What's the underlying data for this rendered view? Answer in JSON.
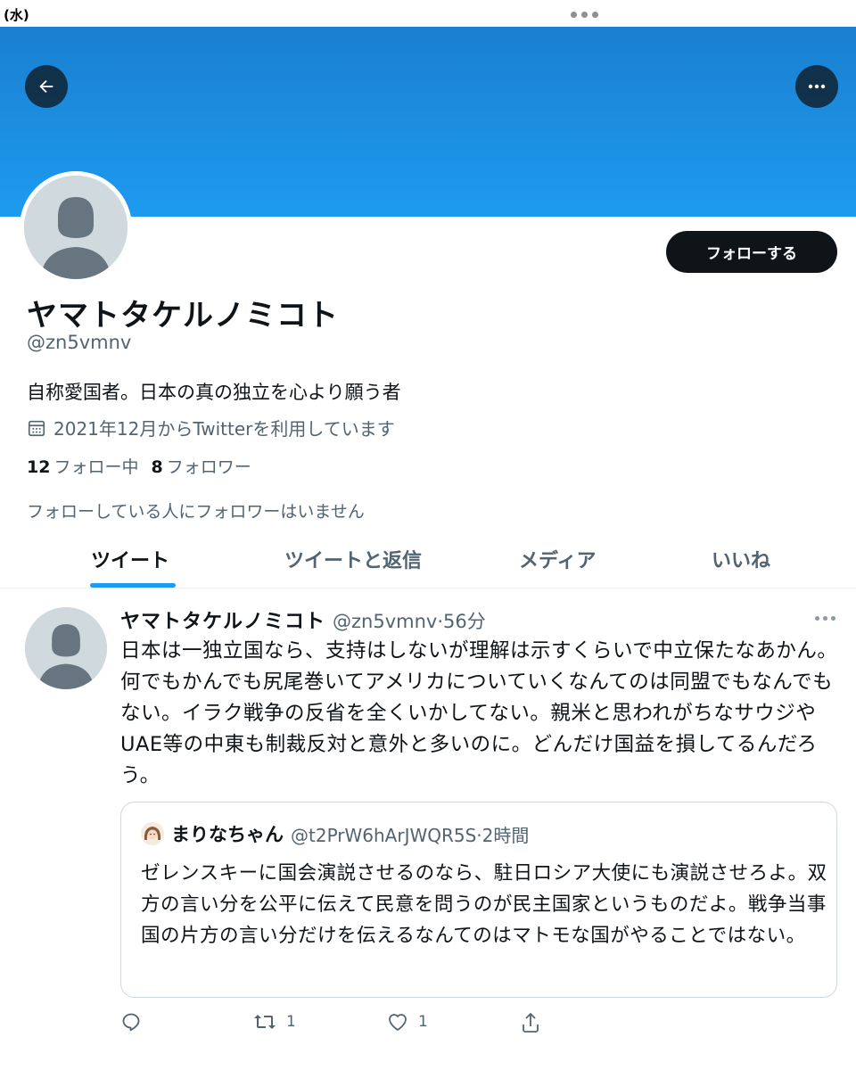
{
  "status_bar": {
    "time": "(水)"
  },
  "profile": {
    "follow_label": "フォローする",
    "display_name": "ヤマトタケルノミコト",
    "handle": "@zn5vmnv",
    "bio": "自称愛国者。日本の真の独立を心より願う者",
    "joined": "2021年12月からTwitterを利用しています",
    "following_count": "12",
    "following_label": "フォロー中",
    "followers_count": "8",
    "followers_label": "フォロワー",
    "followed_by_note": "フォローしている人にフォロワーはいません"
  },
  "tabs": [
    {
      "label": "ツイート",
      "active": true
    },
    {
      "label": "ツイートと返信",
      "active": false
    },
    {
      "label": "メディア",
      "active": false
    },
    {
      "label": "いいね",
      "active": false
    }
  ],
  "tweet": {
    "name": "ヤマトタケルノミコト",
    "meta": "@zn5vmnv·56分",
    "text": "日本は一独立国なら、支持はしないが理解は示すくらいで中立保たなあかん。何でもかんでも尻尾巻いてアメリカについていくなんてのは同盟でもなんでもない。イラク戦争の反省を全くいかしてない。親米と思われがちなサウジやUAE等の中東も制裁反対と意外と多いのに。どんだけ国益を損してるんだろう。",
    "quote": {
      "name": "まりなちゃん",
      "meta": "@t2PrW6hArJWQR5S·2時間",
      "text": "ゼレンスキーに国会演説させるのなら、駐日ロシア大使にも演説させろよ。双方の言い分を公平に伝えて民意を問うのが民主国家というものだよ。戦争当事国の片方の言い分だけを伝えるなんてのはマトモな国がやることではない。"
    },
    "actions": {
      "reply_icon": "reply-icon",
      "retweet_icon": "retweet-icon",
      "retweet_count": "1",
      "like_icon": "heart-icon",
      "like_count": "1",
      "share_icon": "share-icon"
    }
  },
  "colors": {
    "accent": "#1d9bf0",
    "banner": "#1d9bf0",
    "text_primary": "#0f1419",
    "text_secondary": "#536471"
  }
}
